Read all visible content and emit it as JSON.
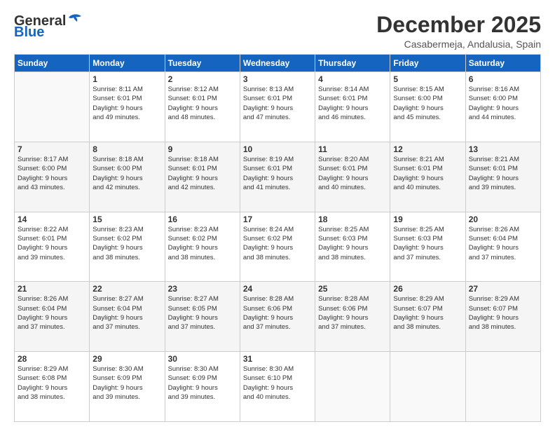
{
  "logo": {
    "general": "General",
    "blue": "Blue"
  },
  "title": "December 2025",
  "subtitle": "Casabermeja, Andalusia, Spain",
  "weekdays": [
    "Sunday",
    "Monday",
    "Tuesday",
    "Wednesday",
    "Thursday",
    "Friday",
    "Saturday"
  ],
  "weeks": [
    [
      {
        "day": "",
        "info": ""
      },
      {
        "day": "1",
        "info": "Sunrise: 8:11 AM\nSunset: 6:01 PM\nDaylight: 9 hours\nand 49 minutes."
      },
      {
        "day": "2",
        "info": "Sunrise: 8:12 AM\nSunset: 6:01 PM\nDaylight: 9 hours\nand 48 minutes."
      },
      {
        "day": "3",
        "info": "Sunrise: 8:13 AM\nSunset: 6:01 PM\nDaylight: 9 hours\nand 47 minutes."
      },
      {
        "day": "4",
        "info": "Sunrise: 8:14 AM\nSunset: 6:01 PM\nDaylight: 9 hours\nand 46 minutes."
      },
      {
        "day": "5",
        "info": "Sunrise: 8:15 AM\nSunset: 6:00 PM\nDaylight: 9 hours\nand 45 minutes."
      },
      {
        "day": "6",
        "info": "Sunrise: 8:16 AM\nSunset: 6:00 PM\nDaylight: 9 hours\nand 44 minutes."
      }
    ],
    [
      {
        "day": "7",
        "info": "Sunrise: 8:17 AM\nSunset: 6:00 PM\nDaylight: 9 hours\nand 43 minutes."
      },
      {
        "day": "8",
        "info": "Sunrise: 8:18 AM\nSunset: 6:00 PM\nDaylight: 9 hours\nand 42 minutes."
      },
      {
        "day": "9",
        "info": "Sunrise: 8:18 AM\nSunset: 6:01 PM\nDaylight: 9 hours\nand 42 minutes."
      },
      {
        "day": "10",
        "info": "Sunrise: 8:19 AM\nSunset: 6:01 PM\nDaylight: 9 hours\nand 41 minutes."
      },
      {
        "day": "11",
        "info": "Sunrise: 8:20 AM\nSunset: 6:01 PM\nDaylight: 9 hours\nand 40 minutes."
      },
      {
        "day": "12",
        "info": "Sunrise: 8:21 AM\nSunset: 6:01 PM\nDaylight: 9 hours\nand 40 minutes."
      },
      {
        "day": "13",
        "info": "Sunrise: 8:21 AM\nSunset: 6:01 PM\nDaylight: 9 hours\nand 39 minutes."
      }
    ],
    [
      {
        "day": "14",
        "info": "Sunrise: 8:22 AM\nSunset: 6:01 PM\nDaylight: 9 hours\nand 39 minutes."
      },
      {
        "day": "15",
        "info": "Sunrise: 8:23 AM\nSunset: 6:02 PM\nDaylight: 9 hours\nand 38 minutes."
      },
      {
        "day": "16",
        "info": "Sunrise: 8:23 AM\nSunset: 6:02 PM\nDaylight: 9 hours\nand 38 minutes."
      },
      {
        "day": "17",
        "info": "Sunrise: 8:24 AM\nSunset: 6:02 PM\nDaylight: 9 hours\nand 38 minutes."
      },
      {
        "day": "18",
        "info": "Sunrise: 8:25 AM\nSunset: 6:03 PM\nDaylight: 9 hours\nand 38 minutes."
      },
      {
        "day": "19",
        "info": "Sunrise: 8:25 AM\nSunset: 6:03 PM\nDaylight: 9 hours\nand 37 minutes."
      },
      {
        "day": "20",
        "info": "Sunrise: 8:26 AM\nSunset: 6:04 PM\nDaylight: 9 hours\nand 37 minutes."
      }
    ],
    [
      {
        "day": "21",
        "info": "Sunrise: 8:26 AM\nSunset: 6:04 PM\nDaylight: 9 hours\nand 37 minutes."
      },
      {
        "day": "22",
        "info": "Sunrise: 8:27 AM\nSunset: 6:04 PM\nDaylight: 9 hours\nand 37 minutes."
      },
      {
        "day": "23",
        "info": "Sunrise: 8:27 AM\nSunset: 6:05 PM\nDaylight: 9 hours\nand 37 minutes."
      },
      {
        "day": "24",
        "info": "Sunrise: 8:28 AM\nSunset: 6:06 PM\nDaylight: 9 hours\nand 37 minutes."
      },
      {
        "day": "25",
        "info": "Sunrise: 8:28 AM\nSunset: 6:06 PM\nDaylight: 9 hours\nand 37 minutes."
      },
      {
        "day": "26",
        "info": "Sunrise: 8:29 AM\nSunset: 6:07 PM\nDaylight: 9 hours\nand 38 minutes."
      },
      {
        "day": "27",
        "info": "Sunrise: 8:29 AM\nSunset: 6:07 PM\nDaylight: 9 hours\nand 38 minutes."
      }
    ],
    [
      {
        "day": "28",
        "info": "Sunrise: 8:29 AM\nSunset: 6:08 PM\nDaylight: 9 hours\nand 38 minutes."
      },
      {
        "day": "29",
        "info": "Sunrise: 8:30 AM\nSunset: 6:09 PM\nDaylight: 9 hours\nand 39 minutes."
      },
      {
        "day": "30",
        "info": "Sunrise: 8:30 AM\nSunset: 6:09 PM\nDaylight: 9 hours\nand 39 minutes."
      },
      {
        "day": "31",
        "info": "Sunrise: 8:30 AM\nSunset: 6:10 PM\nDaylight: 9 hours\nand 40 minutes."
      },
      {
        "day": "",
        "info": ""
      },
      {
        "day": "",
        "info": ""
      },
      {
        "day": "",
        "info": ""
      }
    ]
  ]
}
